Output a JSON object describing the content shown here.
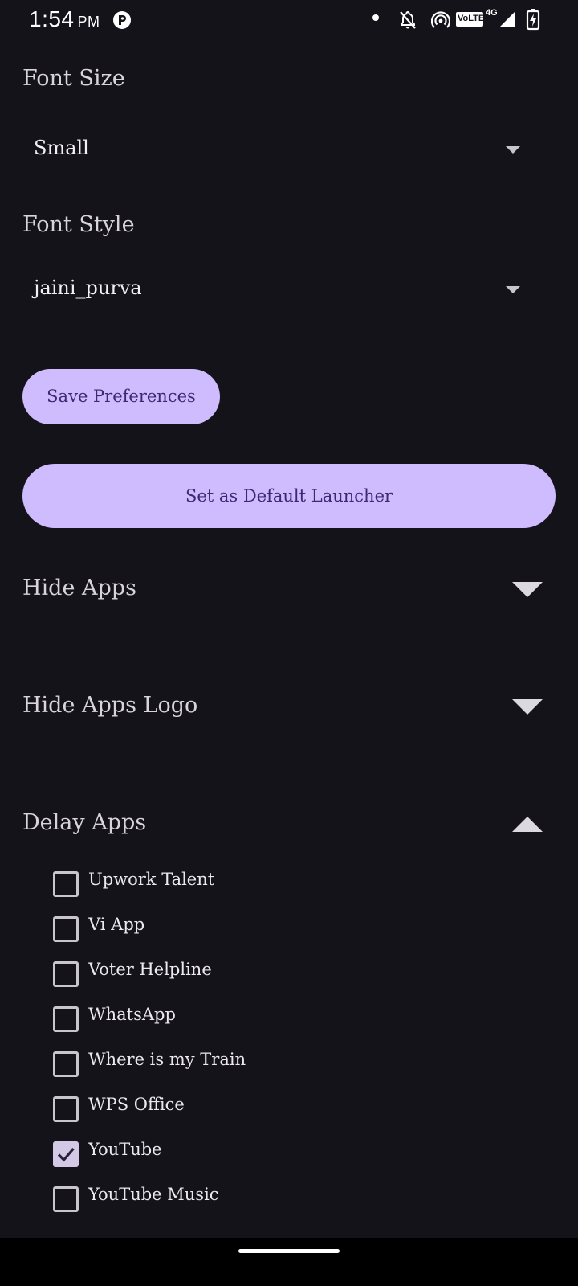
{
  "status_bar": {
    "time": "1:54",
    "ampm": "PM",
    "volte": "VoLTE",
    "network": "4G"
  },
  "font_size": {
    "label": "Font Size",
    "value": "Small"
  },
  "font_style": {
    "label": "Font Style",
    "value": "jaini_purva"
  },
  "buttons": {
    "save": "Save Preferences",
    "default_launcher": "Set as Default Launcher"
  },
  "sections": {
    "hide_apps": "Hide Apps",
    "hide_apps_logo": "Hide Apps Logo",
    "delay_apps": "Delay Apps"
  },
  "delay_apps_list": [
    {
      "name": "Upwork Talent",
      "checked": false
    },
    {
      "name": "Vi App",
      "checked": false
    },
    {
      "name": "Voter Helpline",
      "checked": false
    },
    {
      "name": "WhatsApp",
      "checked": false
    },
    {
      "name": "Where is my Train",
      "checked": false
    },
    {
      "name": "WPS Office",
      "checked": false
    },
    {
      "name": "YouTube",
      "checked": true
    },
    {
      "name": "YouTube Music",
      "checked": false
    }
  ],
  "colors": {
    "background": "#15131a",
    "accent": "#cfbcff",
    "accent_text": "#3a2a73"
  }
}
